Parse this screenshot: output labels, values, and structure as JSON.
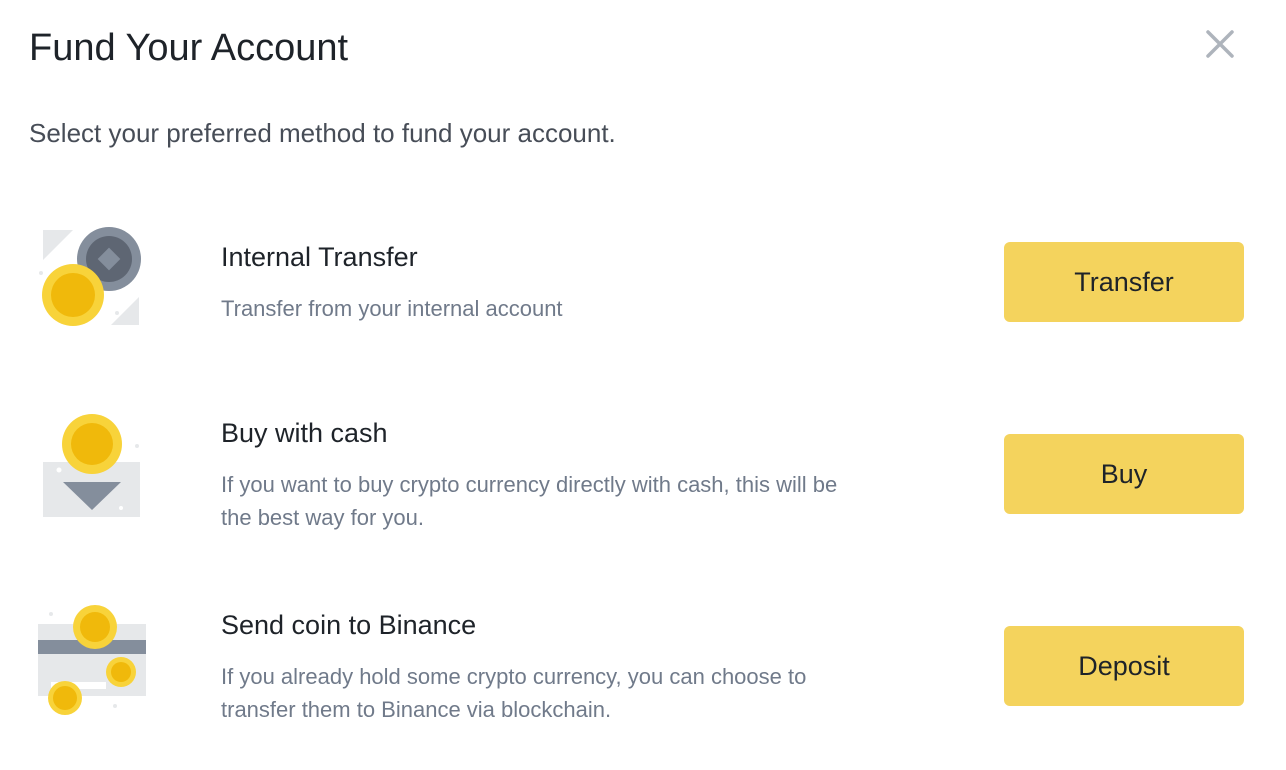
{
  "modal": {
    "title": "Fund Your Account",
    "subtitle": "Select your preferred method to fund your account."
  },
  "options": [
    {
      "title": "Internal Transfer",
      "description": "Transfer from your internal account",
      "button_label": "Transfer",
      "icon": "coins-transfer-icon"
    },
    {
      "title": "Buy with cash",
      "description_line1": "If you want to buy crypto currency directly with cash, this will be",
      "description_line2": "the best way for you.",
      "button_label": "Buy",
      "icon": "coin-cash-icon"
    },
    {
      "title": "Send coin to Binance",
      "description_line1": "If you already hold some crypto currency, you can choose to",
      "description_line2": "transfer them to Binance via blockchain.",
      "button_label": "Deposit",
      "icon": "card-coins-icon"
    }
  ],
  "colors": {
    "button_bg": "#f4d35d",
    "coin_yellow": "#f0b90b",
    "text_primary": "#1e2329",
    "text_secondary": "#707a8a"
  }
}
